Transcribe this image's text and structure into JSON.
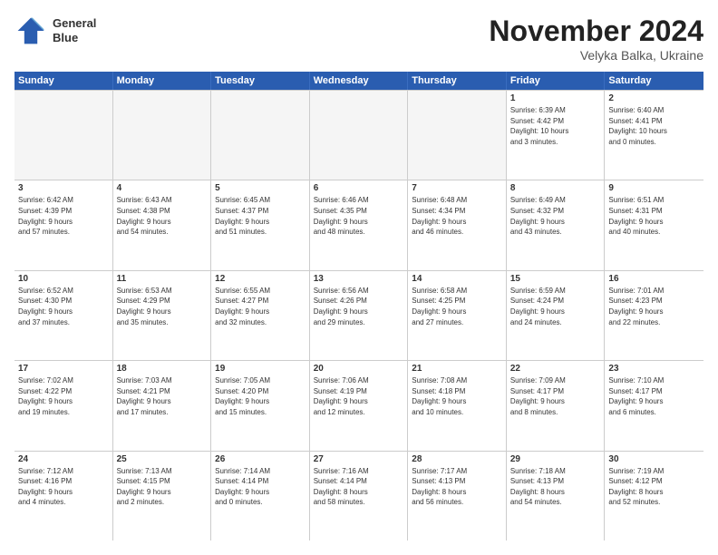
{
  "header": {
    "logo_line1": "General",
    "logo_line2": "Blue",
    "month": "November 2024",
    "location": "Velyka Balka, Ukraine"
  },
  "weekdays": [
    "Sunday",
    "Monday",
    "Tuesday",
    "Wednesday",
    "Thursday",
    "Friday",
    "Saturday"
  ],
  "weeks": [
    [
      {
        "day": "",
        "info": ""
      },
      {
        "day": "",
        "info": ""
      },
      {
        "day": "",
        "info": ""
      },
      {
        "day": "",
        "info": ""
      },
      {
        "day": "",
        "info": ""
      },
      {
        "day": "1",
        "info": "Sunrise: 6:39 AM\nSunset: 4:42 PM\nDaylight: 10 hours\nand 3 minutes."
      },
      {
        "day": "2",
        "info": "Sunrise: 6:40 AM\nSunset: 4:41 PM\nDaylight: 10 hours\nand 0 minutes."
      }
    ],
    [
      {
        "day": "3",
        "info": "Sunrise: 6:42 AM\nSunset: 4:39 PM\nDaylight: 9 hours\nand 57 minutes."
      },
      {
        "day": "4",
        "info": "Sunrise: 6:43 AM\nSunset: 4:38 PM\nDaylight: 9 hours\nand 54 minutes."
      },
      {
        "day": "5",
        "info": "Sunrise: 6:45 AM\nSunset: 4:37 PM\nDaylight: 9 hours\nand 51 minutes."
      },
      {
        "day": "6",
        "info": "Sunrise: 6:46 AM\nSunset: 4:35 PM\nDaylight: 9 hours\nand 48 minutes."
      },
      {
        "day": "7",
        "info": "Sunrise: 6:48 AM\nSunset: 4:34 PM\nDaylight: 9 hours\nand 46 minutes."
      },
      {
        "day": "8",
        "info": "Sunrise: 6:49 AM\nSunset: 4:32 PM\nDaylight: 9 hours\nand 43 minutes."
      },
      {
        "day": "9",
        "info": "Sunrise: 6:51 AM\nSunset: 4:31 PM\nDaylight: 9 hours\nand 40 minutes."
      }
    ],
    [
      {
        "day": "10",
        "info": "Sunrise: 6:52 AM\nSunset: 4:30 PM\nDaylight: 9 hours\nand 37 minutes."
      },
      {
        "day": "11",
        "info": "Sunrise: 6:53 AM\nSunset: 4:29 PM\nDaylight: 9 hours\nand 35 minutes."
      },
      {
        "day": "12",
        "info": "Sunrise: 6:55 AM\nSunset: 4:27 PM\nDaylight: 9 hours\nand 32 minutes."
      },
      {
        "day": "13",
        "info": "Sunrise: 6:56 AM\nSunset: 4:26 PM\nDaylight: 9 hours\nand 29 minutes."
      },
      {
        "day": "14",
        "info": "Sunrise: 6:58 AM\nSunset: 4:25 PM\nDaylight: 9 hours\nand 27 minutes."
      },
      {
        "day": "15",
        "info": "Sunrise: 6:59 AM\nSunset: 4:24 PM\nDaylight: 9 hours\nand 24 minutes."
      },
      {
        "day": "16",
        "info": "Sunrise: 7:01 AM\nSunset: 4:23 PM\nDaylight: 9 hours\nand 22 minutes."
      }
    ],
    [
      {
        "day": "17",
        "info": "Sunrise: 7:02 AM\nSunset: 4:22 PM\nDaylight: 9 hours\nand 19 minutes."
      },
      {
        "day": "18",
        "info": "Sunrise: 7:03 AM\nSunset: 4:21 PM\nDaylight: 9 hours\nand 17 minutes."
      },
      {
        "day": "19",
        "info": "Sunrise: 7:05 AM\nSunset: 4:20 PM\nDaylight: 9 hours\nand 15 minutes."
      },
      {
        "day": "20",
        "info": "Sunrise: 7:06 AM\nSunset: 4:19 PM\nDaylight: 9 hours\nand 12 minutes."
      },
      {
        "day": "21",
        "info": "Sunrise: 7:08 AM\nSunset: 4:18 PM\nDaylight: 9 hours\nand 10 minutes."
      },
      {
        "day": "22",
        "info": "Sunrise: 7:09 AM\nSunset: 4:17 PM\nDaylight: 9 hours\nand 8 minutes."
      },
      {
        "day": "23",
        "info": "Sunrise: 7:10 AM\nSunset: 4:17 PM\nDaylight: 9 hours\nand 6 minutes."
      }
    ],
    [
      {
        "day": "24",
        "info": "Sunrise: 7:12 AM\nSunset: 4:16 PM\nDaylight: 9 hours\nand 4 minutes."
      },
      {
        "day": "25",
        "info": "Sunrise: 7:13 AM\nSunset: 4:15 PM\nDaylight: 9 hours\nand 2 minutes."
      },
      {
        "day": "26",
        "info": "Sunrise: 7:14 AM\nSunset: 4:14 PM\nDaylight: 9 hours\nand 0 minutes."
      },
      {
        "day": "27",
        "info": "Sunrise: 7:16 AM\nSunset: 4:14 PM\nDaylight: 8 hours\nand 58 minutes."
      },
      {
        "day": "28",
        "info": "Sunrise: 7:17 AM\nSunset: 4:13 PM\nDaylight: 8 hours\nand 56 minutes."
      },
      {
        "day": "29",
        "info": "Sunrise: 7:18 AM\nSunset: 4:13 PM\nDaylight: 8 hours\nand 54 minutes."
      },
      {
        "day": "30",
        "info": "Sunrise: 7:19 AM\nSunset: 4:12 PM\nDaylight: 8 hours\nand 52 minutes."
      }
    ]
  ]
}
